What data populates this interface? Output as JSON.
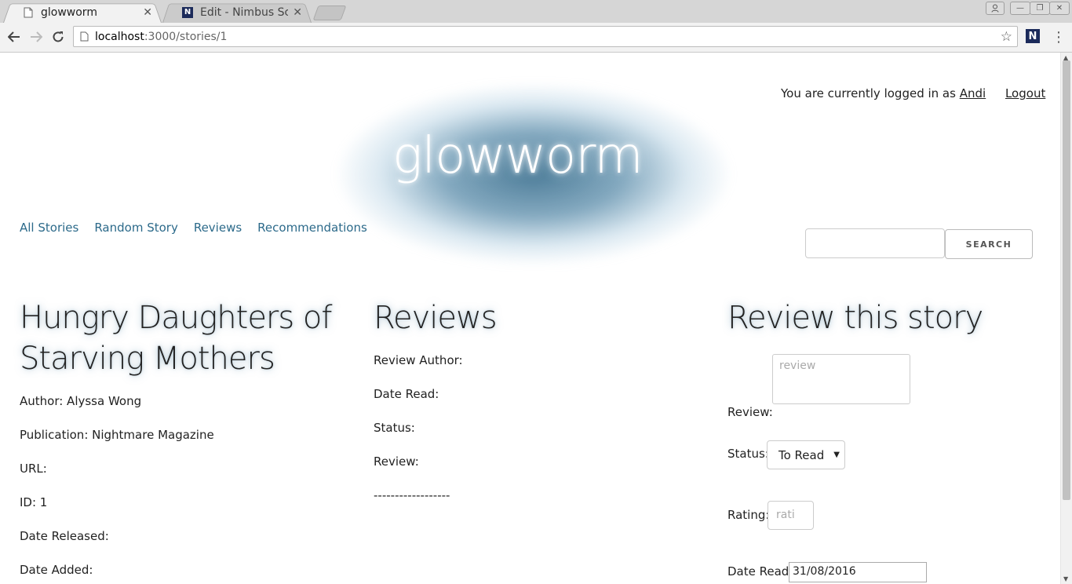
{
  "browser": {
    "tabs": [
      {
        "title": "glowworm",
        "active": true
      },
      {
        "title": "Edit - Nimbus Scree",
        "active": false
      }
    ],
    "url_host": "localhost",
    "url_path": ":3000/stories/1",
    "icons": {
      "back": "back-arrow-icon",
      "forward": "forward-arrow-icon",
      "reload": "reload-icon",
      "star": "star-icon",
      "menu": "menu-dots-icon"
    }
  },
  "header": {
    "login_prefix": "You are currently logged in as",
    "username": "Andi",
    "logout": "Logout",
    "logo": "glowworm"
  },
  "nav": {
    "items": [
      "All Stories",
      "Random Story",
      "Reviews",
      "Recommendations"
    ]
  },
  "search": {
    "button": "SEARCH",
    "value": ""
  },
  "story": {
    "title_line1": "Hungry Daughters of",
    "title_line2": "Starving Mothers",
    "author": "Author: Alyssa Wong",
    "publication": "Publication: Nightmare Magazine",
    "url": "URL:",
    "id": "ID: 1",
    "date_released": "Date Released:",
    "date_added": "Date Added:"
  },
  "reviews": {
    "heading": "Reviews",
    "review_author": "Review Author:",
    "date_read": "Date Read:",
    "status": "Status:",
    "review": "Review:",
    "separator": "------------------"
  },
  "review_form": {
    "heading": "Review this story",
    "review_label": "Review:",
    "review_placeholder": "review",
    "status_label": "Status:",
    "status_value": "To Read",
    "rating_label": "Rating:",
    "rating_placeholder": "rati",
    "date_label": "Date Read:",
    "date_value": "31/08/2016"
  },
  "colors": {
    "nav_link": "#2c6a8a",
    "logo_glow": "#4a7f9c"
  }
}
